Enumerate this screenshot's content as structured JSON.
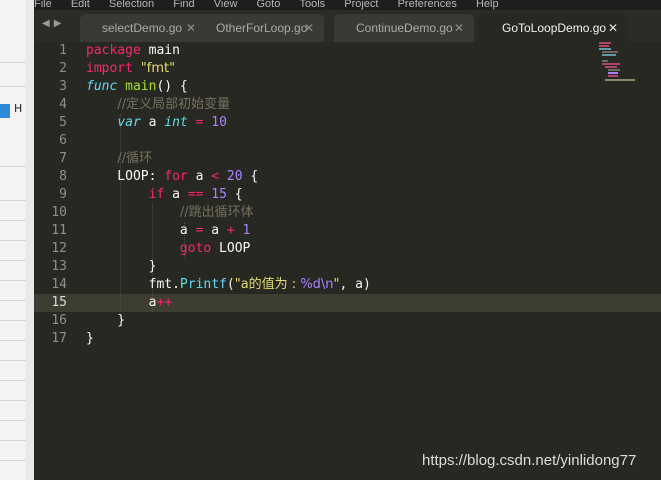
{
  "menu": [
    "File",
    "Edit",
    "Selection",
    "Find",
    "View",
    "Goto",
    "Tools",
    "Project",
    "Preferences",
    "Help"
  ],
  "side_window": {
    "label": "H"
  },
  "tabs": [
    {
      "label": "selectDemo.go",
      "active": false
    },
    {
      "label": "OtherForLoop.go",
      "active": false
    },
    {
      "label": "ContinueDemo.go",
      "active": false
    },
    {
      "label": "GoToLoopDemo.go",
      "active": true
    }
  ],
  "editor": {
    "current_line": 15,
    "line_numbers": [
      "1",
      "2",
      "3",
      "4",
      "5",
      "6",
      "7",
      "8",
      "9",
      "10",
      "11",
      "12",
      "13",
      "14",
      "15",
      "16",
      "17"
    ],
    "lines": [
      "package main",
      "import \"fmt\"",
      "func main() {",
      "    //定义局部初始变量",
      "    var a int = 10",
      "",
      "    //循环",
      "    LOOP: for a < 20 {",
      "        if a == 15 {",
      "            //跳出循环体",
      "            a = a + 1",
      "            goto LOOP",
      "        }",
      "        fmt.Printf(\"a的值为 : %d\\n\", a)",
      "        a++",
      "    }",
      "}"
    ]
  },
  "colors": {
    "background": "#272822",
    "keyword": "#f92672",
    "type": "#66d9ef",
    "function": "#a6e22e",
    "string": "#e6db74",
    "number": "#ae81ff",
    "comment": "#75715e"
  },
  "icons": {
    "tab_close": "close-icon",
    "nav": "tab-nav-arrows-icon"
  },
  "watermark": "https://blog.csdn.net/yinlidong77"
}
